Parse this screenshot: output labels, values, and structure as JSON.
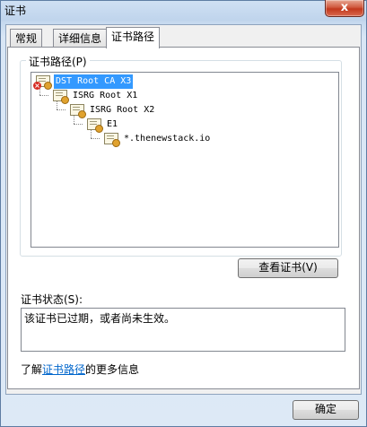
{
  "window": {
    "title": "证书",
    "close_symbol": "x"
  },
  "tabs": [
    {
      "label": "常规"
    },
    {
      "label": "详细信息"
    },
    {
      "label": "证书路径"
    }
  ],
  "cert_path": {
    "group_label": "证书路径(P)",
    "nodes": [
      {
        "label": "DST Root CA X3",
        "selected": true,
        "error": true
      },
      {
        "label": "ISRG Root X1"
      },
      {
        "label": "ISRG Root X2"
      },
      {
        "label": "E1"
      },
      {
        "label": "*.thenewstack.io"
      }
    ],
    "view_button": "查看证书(V)"
  },
  "status": {
    "label": "证书状态(S):",
    "text": "该证书已过期，或者尚未生效。"
  },
  "learn_more": {
    "prefix": "了解",
    "link": "证书路径",
    "suffix": "的更多信息"
  },
  "ok_button": "确定"
}
